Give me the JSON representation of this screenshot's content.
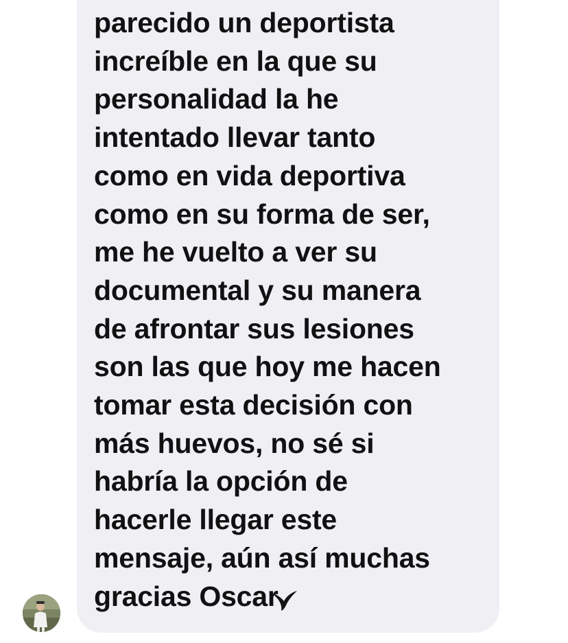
{
  "conversation": {
    "message": {
      "lines": [
        "parecido un deportista",
        "increíble en la que su",
        "personalidad la he",
        "intentado llevar tanto",
        "como en vida deportiva",
        "como en su forma de ser,",
        "me he vuelto a ver su",
        "documental y su manera",
        "de afrontar sus lesiones",
        "son las que hoy me hacen",
        "tomar esta decisión con",
        "más huevos, no sé si",
        "habría la opción de",
        "hacerle llegar este",
        "mensaje, aún así muchas",
        "gracias Oscar"
      ],
      "bubble_color": "#efeff4",
      "text_color": "#111111"
    },
    "sender_avatar": {
      "icon": "profile-photo"
    },
    "overlay_icon": "brush-stroke-icon"
  }
}
